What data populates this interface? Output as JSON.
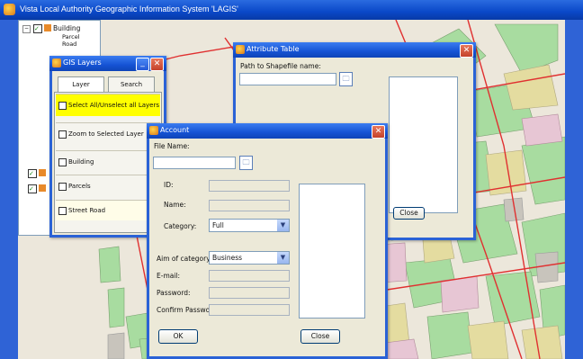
{
  "app": {
    "title": "Vista Local Authority Geographic Information System 'LAGIS'"
  },
  "tree": {
    "root_label": "Building",
    "children": [
      "Parcel",
      "Road"
    ]
  },
  "layer_settings": {
    "title": "GIS Layers",
    "tabs": [
      "Layer",
      "Search"
    ],
    "layers": [
      {
        "label": "Select All/Unselect all Layers",
        "checked": false,
        "highlighted": true
      },
      {
        "label": "Zoom to Selected Layer",
        "checked": false,
        "highlighted": false
      },
      {
        "label": "Building",
        "checked": false,
        "highlighted": false
      },
      {
        "label": "Parcels",
        "checked": false,
        "highlighted": false
      },
      {
        "label": "Street Road",
        "checked": false,
        "highlighted": true
      }
    ]
  },
  "back_window": {
    "title": "Attribute Table",
    "field_label": "Path to Shapefile name:",
    "close_label": "Close"
  },
  "front_window": {
    "title": "Account",
    "file_label": "File Name:",
    "fields": [
      {
        "label": "ID:"
      },
      {
        "label": "Name:"
      },
      {
        "label": "Category:",
        "value": "Full"
      },
      {
        "label": "Aim of category:",
        "value": "Business"
      },
      {
        "label": "E-mail:"
      },
      {
        "label": "Password:"
      },
      {
        "label": "Confirm Password:"
      }
    ],
    "ok_label": "OK",
    "close_label": "Close"
  },
  "colors": {
    "titlebar": "#0a48c8",
    "highlight": "#ffff00",
    "map_bg": "#e9e4d8",
    "parcel_green": "#a8dca0",
    "road_red": "#e03030"
  }
}
